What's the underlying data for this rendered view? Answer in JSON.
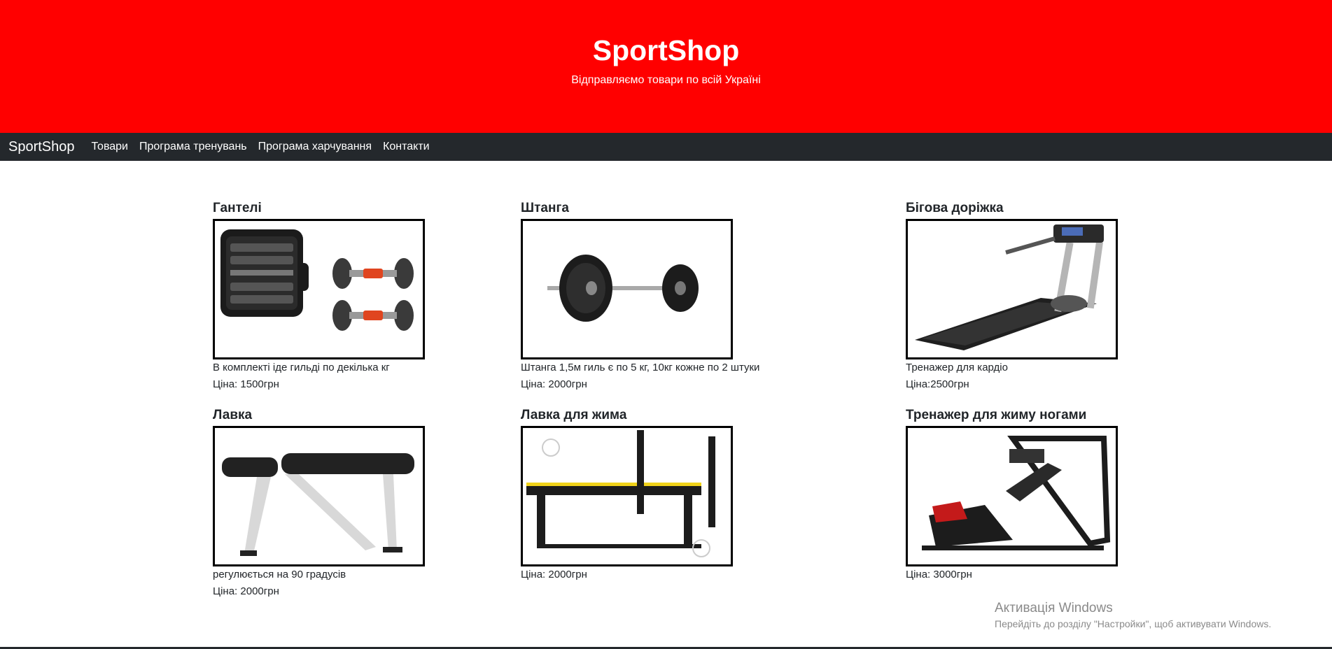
{
  "header": {
    "title": "SportShop",
    "subtitle": "Відправляємо товари по всій Україні",
    "background": "#ff0000"
  },
  "navbar": {
    "brand": "SportShop",
    "links": [
      "Товари",
      "Програма тренувань",
      "Програма харчування",
      "Контакти"
    ],
    "background": "#24282c"
  },
  "products": [
    {
      "title": "Гантелі",
      "description": "В комплекті іде гильді по декілька кг",
      "price": "Ціна: 1500грн",
      "image": "dumbbell-set-image"
    },
    {
      "title": "Штанга",
      "description": "Штанга 1,5м гиль є по 5 кг, 10кг кожне по 2 штуки",
      "price": "Ціна: 2000грн",
      "image": "barbell-image"
    },
    {
      "title": "Бігова доріжка",
      "description": "Тренажер для кардіо",
      "price": "Ціна:2500грн",
      "image": "treadmill-image"
    },
    {
      "title": "Лавка",
      "description": "регулюється на 90 градусів",
      "price": "Ціна: 2000грн",
      "image": "adjustable-bench-image"
    },
    {
      "title": "Лавка для жима",
      "price": "Ціна: 2000грн",
      "image": "bench-press-image"
    },
    {
      "title": "Тренажер для жиму ногами",
      "price": "Ціна: 3000грн",
      "image": "leg-press-image"
    }
  ],
  "watermark": {
    "title": "Активація Windows",
    "subtitle": "Перейдіть до розділу \"Настройки\", щоб активувати Windows."
  }
}
